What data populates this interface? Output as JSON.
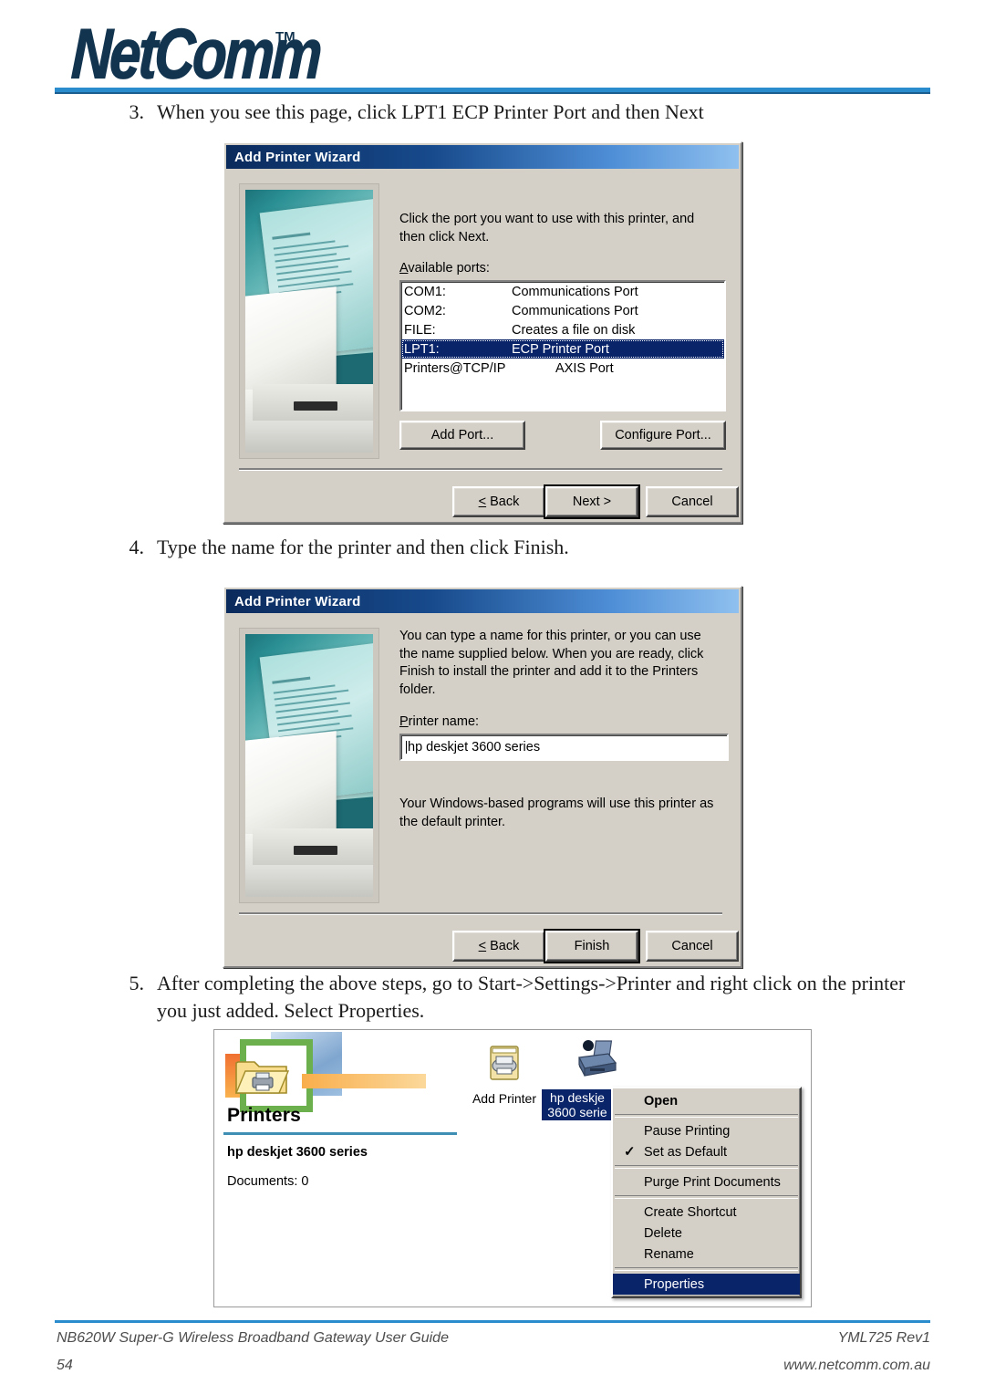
{
  "header": {
    "logo_text": "NetComm",
    "logo_tm": "TM"
  },
  "steps": [
    {
      "number": "3.",
      "text": "When you see this page, click LPT1 ECP Printer Port and then Next"
    },
    {
      "number": "4.",
      "text": "Type the name for the printer and then click Finish."
    },
    {
      "number": "5.",
      "text": "After completing the above steps, go to Start->Settings->Printer and right click on the printer you just added.  Select Properties."
    }
  ],
  "dialog_port": {
    "title": "Add Printer Wizard",
    "instruction": "Click the port you want to use with this printer, and then click Next.",
    "ports_label": "Available ports:",
    "ports": [
      {
        "port": "COM1:",
        "description": "Communications Port",
        "selected": false
      },
      {
        "port": "COM2:",
        "description": "Communications Port",
        "selected": false
      },
      {
        "port": "FILE:",
        "description": "Creates a file on disk",
        "selected": false
      },
      {
        "port": "LPT1:",
        "description": "ECP Printer Port",
        "selected": true
      },
      {
        "port": "Printers@TCP/IP",
        "description": "AXIS Port",
        "selected": false
      }
    ],
    "add_port_label": "Add Port...",
    "configure_port_label": "Configure Port...",
    "back_label": "< Back",
    "next_label": "Next >",
    "cancel_label": "Cancel"
  },
  "dialog_name": {
    "title": "Add Printer Wizard",
    "instruction": "You can type a name for this printer, or you can use the name supplied below. When you are ready, click Finish to install the printer and add it to the Printers folder.",
    "printer_name_label": "Printer name:",
    "printer_name_value": "hp deskjet 3600 series",
    "default_note": "Your Windows-based programs will use this printer as the default printer.",
    "back_label": "< Back",
    "finish_label": "Finish",
    "cancel_label": "Cancel"
  },
  "printers_window": {
    "title": "Printers",
    "selected_printer": "hp deskjet 3600 series",
    "documents_text": "Documents: 0",
    "icons": [
      {
        "label": "Add Printer",
        "selected": false
      },
      {
        "label_line1": "hp deskje",
        "label_line2": "3600 serie",
        "selected": true
      }
    ],
    "context_menu": [
      {
        "label": "Open",
        "bold": true,
        "checked": false,
        "highlighted": false
      },
      {
        "separator": true
      },
      {
        "label": "Pause Printing",
        "bold": false,
        "checked": false,
        "highlighted": false
      },
      {
        "label": "Set as Default",
        "bold": false,
        "checked": true,
        "highlighted": false
      },
      {
        "separator": true
      },
      {
        "label": "Purge Print Documents",
        "bold": false,
        "checked": false,
        "highlighted": false
      },
      {
        "separator": true
      },
      {
        "label": "Create Shortcut",
        "bold": false,
        "checked": false,
        "highlighted": false
      },
      {
        "label": "Delete",
        "bold": false,
        "checked": false,
        "highlighted": false
      },
      {
        "label": "Rename",
        "bold": false,
        "checked": false,
        "highlighted": false
      },
      {
        "separator": true
      },
      {
        "label": "Properties",
        "bold": false,
        "checked": false,
        "highlighted": true
      }
    ],
    "check_glyph": "✓"
  },
  "footer": {
    "left_line1": "NB620W Super-G Wireless Broadband  Gateway User Guide",
    "left_line2": "54",
    "right_line1": "YML725 Rev1",
    "right_line2": "www.netcomm.com.au"
  },
  "colors": {
    "accent_blue": "#2a8ccd",
    "brand_navy": "#12344f",
    "selection": "#0a246a",
    "dialog_face": "#d4d0c8"
  }
}
